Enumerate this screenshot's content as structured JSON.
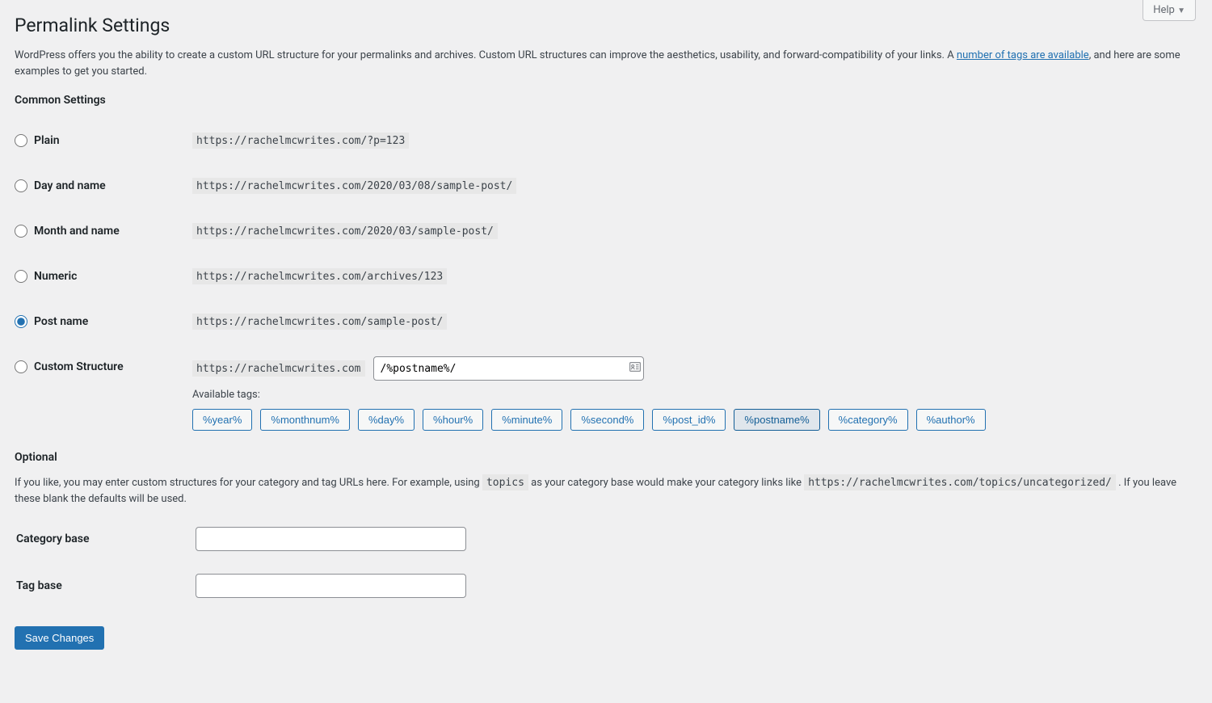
{
  "help": {
    "label": "Help"
  },
  "page": {
    "title": "Permalink Settings",
    "intro_before": "WordPress offers you the ability to create a custom URL structure for your permalinks and archives. Custom URL structures can improve the aesthetics, usability, and forward-compatibility of your links. A ",
    "intro_link": "number of tags are available",
    "intro_after": ", and here are some examples to get you started."
  },
  "common": {
    "heading": "Common Settings",
    "options": [
      {
        "label": "Plain",
        "example": "https://rachelmcwrites.com/?p=123",
        "checked": false
      },
      {
        "label": "Day and name",
        "example": "https://rachelmcwrites.com/2020/03/08/sample-post/",
        "checked": false
      },
      {
        "label": "Month and name",
        "example": "https://rachelmcwrites.com/2020/03/sample-post/",
        "checked": false
      },
      {
        "label": "Numeric",
        "example": "https://rachelmcwrites.com/archives/123",
        "checked": false
      },
      {
        "label": "Post name",
        "example": "https://rachelmcwrites.com/sample-post/",
        "checked": true
      }
    ],
    "custom": {
      "label": "Custom Structure",
      "base_url": "https://rachelmcwrites.com",
      "value": "/%postname%/",
      "available_label": "Available tags:",
      "tags": [
        {
          "text": "%year%",
          "active": false
        },
        {
          "text": "%monthnum%",
          "active": false
        },
        {
          "text": "%day%",
          "active": false
        },
        {
          "text": "%hour%",
          "active": false
        },
        {
          "text": "%minute%",
          "active": false
        },
        {
          "text": "%second%",
          "active": false
        },
        {
          "text": "%post_id%",
          "active": false
        },
        {
          "text": "%postname%",
          "active": true
        },
        {
          "text": "%category%",
          "active": false
        },
        {
          "text": "%author%",
          "active": false
        }
      ]
    }
  },
  "optional": {
    "heading": "Optional",
    "blurb_before": "If you like, you may enter custom structures for your category and tag URLs here. For example, using ",
    "blurb_code1": "topics",
    "blurb_mid": " as your category base would make your category links like ",
    "blurb_code2": "https://rachelmcwrites.com/topics/uncategorized/",
    "blurb_after": " . If you leave these blank the defaults will be used.",
    "category_label": "Category base",
    "category_value": "",
    "tag_label": "Tag base",
    "tag_value": ""
  },
  "submit": {
    "label": "Save Changes"
  }
}
